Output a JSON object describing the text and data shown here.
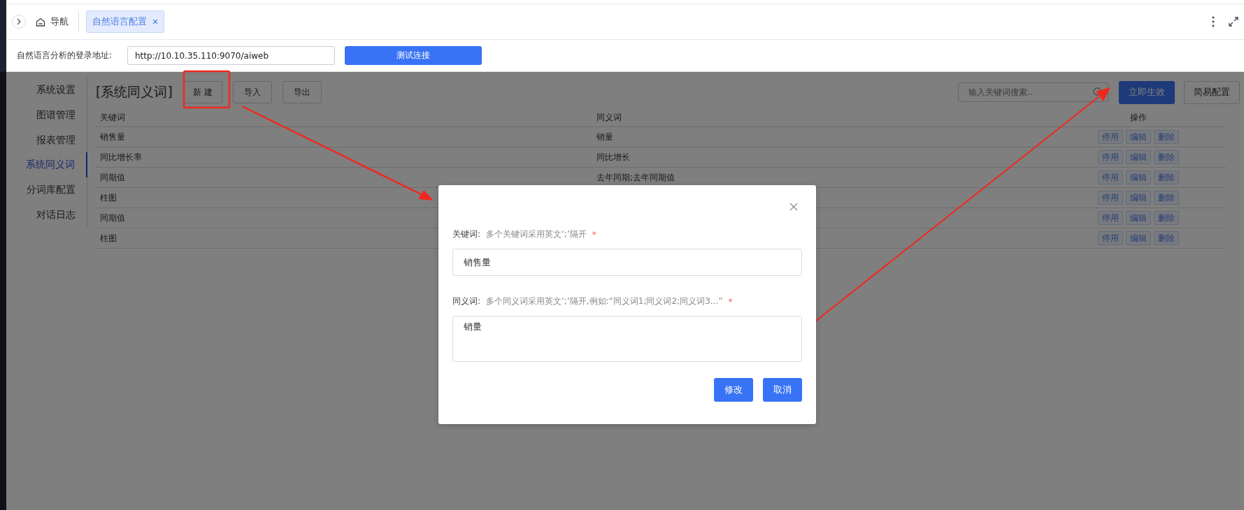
{
  "tab_bar": {
    "nav": "导航",
    "tabs": [
      {
        "label": "自然语言配置",
        "selected": true
      }
    ]
  },
  "url_row": {
    "label": "自然语言分析的登录地址:",
    "value": "http://10.10.35.110:9070/aiweb",
    "button": "测试连接"
  },
  "sidebar": {
    "items": [
      {
        "label": "系统设置",
        "selected": false
      },
      {
        "label": "图谱管理",
        "selected": false
      },
      {
        "label": "报表管理",
        "selected": false
      },
      {
        "label": "系统同义词",
        "selected": true
      },
      {
        "label": "分词库配置",
        "selected": false
      },
      {
        "label": "对话日志",
        "selected": false
      }
    ]
  },
  "toolbar": {
    "title": "[系统同义词]",
    "buttons": [
      "新 建",
      "导入",
      "导出"
    ],
    "search_placeholder": "输入关键词搜索..",
    "apply_button": "立即生效",
    "simple_button": "简易配置"
  },
  "table": {
    "columns": [
      "关键词",
      "同义词",
      "操作"
    ],
    "rows": [
      {
        "keyword": "销售量",
        "synonym": "销量",
        "actions": [
          "停用",
          "编辑",
          "删除"
        ]
      },
      {
        "keyword": "同比增长率",
        "synonym": "同比增长",
        "actions": [
          "停用",
          "编辑",
          "删除"
        ]
      },
      {
        "keyword": "同期值",
        "synonym": "去年同期;去年同期值",
        "actions": [
          "停用",
          "编辑",
          "删除"
        ]
      },
      {
        "keyword": "柱图",
        "actions": [
          "停用",
          "编辑",
          "删除"
        ]
      },
      {
        "keyword": "同期值",
        "actions": [
          "停用",
          "编辑",
          "删除"
        ]
      },
      {
        "keyword": "柱图",
        "actions": [
          "停用",
          "编辑",
          "删除"
        ]
      }
    ]
  },
  "dialog": {
    "fields": [
      {
        "kind": "input",
        "label": "关键词:",
        "hint": "多个关键词采用英文‘;’隔开",
        "required_mark": "*",
        "value": "销售量"
      },
      {
        "kind": "textarea",
        "label": "同义词:",
        "hint": "多个同义词采用英文‘;’隔开,例如:“同义词1;同义词2;同义词3...”",
        "required_mark": "*",
        "value": "销量"
      }
    ],
    "buttons": [
      "修改",
      "取消"
    ]
  }
}
